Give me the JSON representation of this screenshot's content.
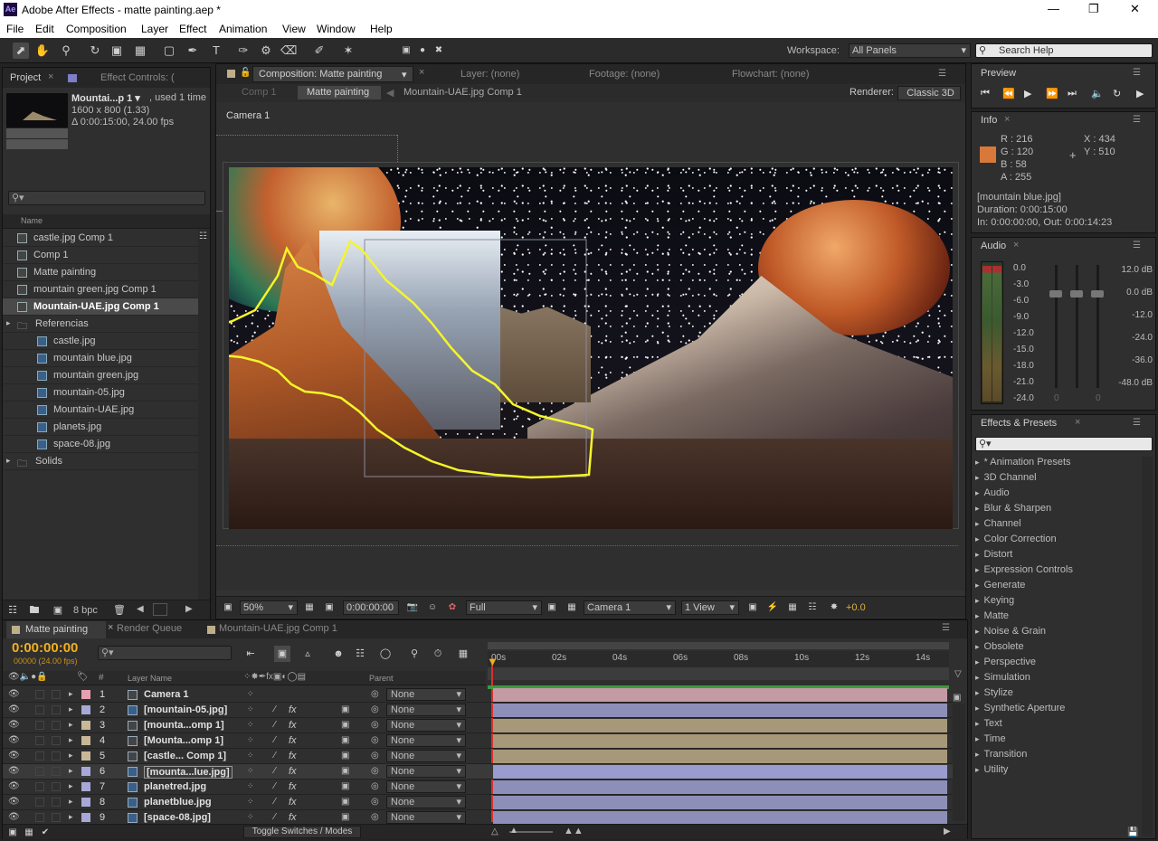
{
  "window": {
    "title": "Adobe After Effects - matte painting.aep *",
    "app_badge": "Ae"
  },
  "menu": [
    "File",
    "Edit",
    "Composition",
    "Layer",
    "Effect",
    "Animation",
    "View",
    "Window",
    "Help"
  ],
  "toolbar": {
    "workspace_label": "Workspace:",
    "workspace_value": "All Panels",
    "search_placeholder": "Search Help"
  },
  "project": {
    "tab_project": "Project",
    "tab_effect": "Effect Controls: (",
    "item_name": "Mountai...p 1 ▾",
    "item_used": ", used 1 time",
    "item_size": "1600 x 800 (1.33)",
    "item_dur": "Δ 0:00:15:00, 24.00 fps",
    "col_name": "Name",
    "items": [
      {
        "label": "castle.jpg Comp 1",
        "type": "comp"
      },
      {
        "label": "Comp 1",
        "type": "comp"
      },
      {
        "label": "Matte painting",
        "type": "comp"
      },
      {
        "label": "mountain green.jpg Comp 1",
        "type": "comp"
      },
      {
        "label": "Mountain-UAE.jpg Comp 1",
        "type": "comp"
      },
      {
        "label": "Referencias",
        "type": "folder"
      },
      {
        "label": "castle.jpg",
        "type": "image"
      },
      {
        "label": "mountain blue.jpg",
        "type": "image"
      },
      {
        "label": "mountain green.jpg",
        "type": "image"
      },
      {
        "label": "mountain-05.jpg",
        "type": "image"
      },
      {
        "label": "Mountain-UAE.jpg",
        "type": "image"
      },
      {
        "label": "planets.jpg",
        "type": "image"
      },
      {
        "label": "space-08.jpg",
        "type": "image"
      },
      {
        "label": "Solids",
        "type": "folder"
      }
    ],
    "bpc": "8 bpc"
  },
  "comp": {
    "tab_comp": "Composition: Matte painting",
    "tab_layer": "Layer: (none)",
    "tab_footage": "Footage: (none)",
    "tab_flowchart": "Flowchart: (none)",
    "crumb_1": "Comp 1",
    "crumb_2": "Matte painting",
    "crumb_3": "Mountain-UAE.jpg Comp 1",
    "renderer_label": "Renderer:",
    "renderer_value": "Classic 3D",
    "camera_label": "Camera 1",
    "zoom": "50%",
    "timecode": "0:00:00:00",
    "resolution": "Full",
    "camera_select": "Camera 1",
    "view_select": "1 View",
    "exposure": "+0.0"
  },
  "preview": {
    "tab": "Preview"
  },
  "info": {
    "tab": "Info",
    "r": "R : 216",
    "g": "G : 120",
    "b": "B : 58",
    "a": "A : 255",
    "x": "X : 434",
    "y": "Y : 510",
    "swatch": "#d8783a",
    "file": "[mountain blue.jpg]",
    "duration": "Duration: 0:00:15:00",
    "inout": "In: 0:00:00:00, Out: 0:00:14:23"
  },
  "audio": {
    "tab": "Audio",
    "left_scale": [
      "0.0",
      "-3.0",
      "-6.0",
      "-9.0",
      "-12.0",
      "-15.0",
      "-18.0",
      "-21.0",
      "-24.0"
    ],
    "right_scale": [
      "12.0 dB",
      "0.0 dB",
      "-12.0",
      "-24.0",
      "-36.0",
      "-48.0 dB"
    ],
    "zero_a": "0",
    "zero_b": "0"
  },
  "effects": {
    "tab": "Effects & Presets",
    "items": [
      "* Animation Presets",
      "3D Channel",
      "Audio",
      "Blur & Sharpen",
      "Channel",
      "Color Correction",
      "Distort",
      "Expression Controls",
      "Generate",
      "Keying",
      "Matte",
      "Noise & Grain",
      "Obsolete",
      "Perspective",
      "Simulation",
      "Stylize",
      "Synthetic Aperture",
      "Text",
      "Time",
      "Transition",
      "Utility"
    ]
  },
  "timeline": {
    "tab_main": "Matte painting",
    "tab_render": "Render Queue",
    "tab_other": "Mountain-UAE.jpg Comp 1",
    "timecode": "0:00:00:00",
    "fps": "00000 (24.00 fps)",
    "col_num": "#",
    "col_layer": "Layer Name",
    "col_parent": "Parent",
    "ruler": [
      "00s",
      "02s",
      "04s",
      "06s",
      "08s",
      "10s",
      "12s",
      "14s"
    ],
    "toggle": "Toggle Switches / Modes",
    "layers": [
      {
        "num": "1",
        "name": "Camera 1",
        "color": "#e8a0b0",
        "type": "camera",
        "parent": "None",
        "bar": "#c49aa4"
      },
      {
        "num": "2",
        "name": "[mountain-05.jpg]",
        "color": "#a8a8d8",
        "type": "image",
        "parent": "None",
        "bar": "#8e8fb8"
      },
      {
        "num": "3",
        "name": "[mounta...omp 1]",
        "color": "#c8b898",
        "type": "comp",
        "parent": "None",
        "bar": "#a8987a"
      },
      {
        "num": "4",
        "name": "[Mounta...omp 1]",
        "color": "#c8b898",
        "type": "comp",
        "parent": "None",
        "bar": "#a8987a"
      },
      {
        "num": "5",
        "name": "[castle... Comp 1]",
        "color": "#c8b898",
        "type": "comp",
        "parent": "None",
        "bar": "#a8987a"
      },
      {
        "num": "6",
        "name": "[mounta...lue.jpg]",
        "color": "#a8a8d8",
        "type": "image",
        "parent": "None",
        "bar": "#9a9cd0"
      },
      {
        "num": "7",
        "name": "planetred.jpg",
        "color": "#a8a8d8",
        "type": "image",
        "parent": "None",
        "bar": "#8e8fb8"
      },
      {
        "num": "8",
        "name": "planetblue.jpg",
        "color": "#a8a8d8",
        "type": "image",
        "parent": "None",
        "bar": "#8e8fb8"
      },
      {
        "num": "9",
        "name": "[space-08.jpg]",
        "color": "#a8a8d8",
        "type": "image",
        "parent": "None",
        "bar": "#8e8fb8"
      }
    ]
  }
}
